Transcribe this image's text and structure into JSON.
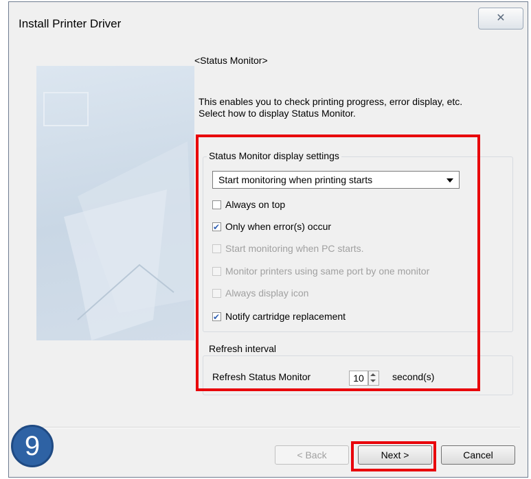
{
  "window": {
    "title": "Install Printer Driver",
    "close_glyph": "✕",
    "close_icon": "close-icon"
  },
  "page": {
    "heading": "<Status Monitor>",
    "description_line1": "This enables you to check printing progress, error display, etc.",
    "description_line2": "Select how to display Status Monitor."
  },
  "display_settings": {
    "title": "Status Monitor display settings",
    "mode_selected": "Start monitoring when printing starts",
    "options": [
      {
        "label": "Always on top",
        "checked": false,
        "enabled": true
      },
      {
        "label": "Only when error(s) occur",
        "checked": true,
        "enabled": true
      },
      {
        "label": "Start monitoring when PC starts.",
        "checked": false,
        "enabled": false
      },
      {
        "label": "Monitor printers using same port by one monitor",
        "checked": false,
        "enabled": false
      },
      {
        "label": "Always display icon",
        "checked": false,
        "enabled": false
      },
      {
        "label": "Notify cartridge replacement",
        "checked": true,
        "enabled": true
      }
    ]
  },
  "refresh": {
    "title": "Refresh interval",
    "label": "Refresh Status Monitor",
    "value": "10",
    "unit": "second(s)"
  },
  "buttons": {
    "back": "< Back",
    "next": "Next >",
    "cancel": "Cancel"
  },
  "step_badge": "9",
  "colors": {
    "highlight": "#e8000a",
    "badge": "#2e62a4"
  }
}
